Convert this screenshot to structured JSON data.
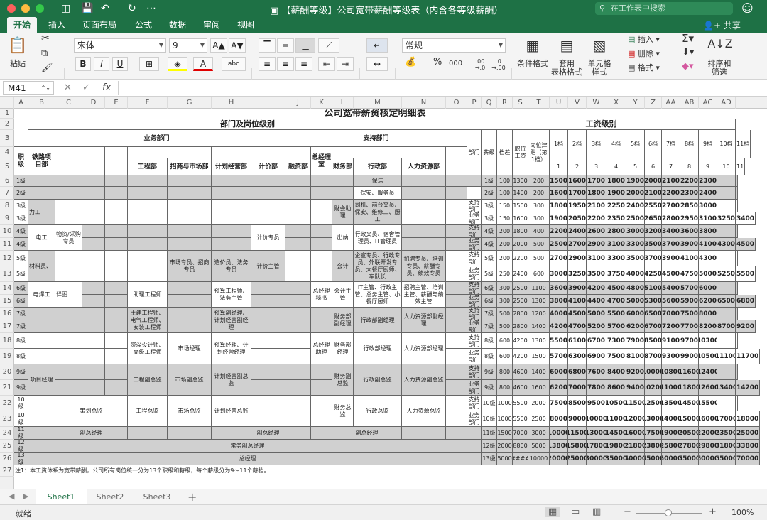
{
  "window": {
    "title": "【薪酬等级】公司宽带薪酬等级表（内含各等级薪酬）",
    "search_placeholder": "在工作表中搜索"
  },
  "menu_tabs": [
    "开始",
    "插入",
    "页面布局",
    "公式",
    "数据",
    "审阅",
    "视图"
  ],
  "share_label": "共享",
  "ribbon": {
    "paste": "粘贴",
    "font_name": "宋体",
    "font_size": "9",
    "bold": "B",
    "italic": "I",
    "underline": "U",
    "font_grow": "A",
    "font_shrink": "A",
    "number_format": "常规",
    "percent": "%",
    "thousands": "000",
    "dec_inc": ".00 →.0",
    "dec_dec": ".0 →.00",
    "cond_format": "条件格式",
    "table_format": "套用\n表格格式",
    "cell_style": "单元格\n样式",
    "insert": "插入",
    "delete": "删除",
    "format": "格式",
    "sort_filter": "排序和\n筛选",
    "icons": {
      "cut": "scissors-icon",
      "copy": "copy-icon",
      "brush": "format-painter-icon",
      "fill": "fill-color-icon",
      "sum": "autosum-icon"
    }
  },
  "formula_bar": {
    "name_box": "M41",
    "fx": "fx"
  },
  "columns": [
    "A",
    "B",
    "C",
    "D",
    "E",
    "F",
    "G",
    "H",
    "I",
    "J",
    "K",
    "L",
    "M",
    "N",
    "O",
    "P",
    "Q",
    "R",
    "S",
    "T",
    "U",
    "V",
    "W",
    "X",
    "Y",
    "Z",
    "AA",
    "AB",
    "AC",
    "AD"
  ],
  "rows": [
    "1",
    "2",
    "3",
    "4",
    "5",
    "6",
    "7",
    "8",
    "9",
    "10",
    "11",
    "12",
    "13",
    "14",
    "15",
    "16",
    "17",
    "18",
    "19",
    "20",
    "21",
    "22",
    "23",
    "24",
    "25",
    "26",
    "27"
  ],
  "sheet": {
    "title": "公司宽带薪资核定明细表",
    "dept_level": "部门及岗位级别",
    "salary_level": "工资级别",
    "business_dept": "业务部门",
    "support_dept": "支持部门",
    "rank": "职级",
    "railway_dept": "铁路项目部",
    "engineering": "工程部",
    "bidding": "招商与市场部",
    "planning": "计划经营部",
    "pricing": "计价部",
    "finance": "融资部",
    "gm_office": "总经理室",
    "finance2": "财务部",
    "admin": "行政部",
    "hr": "人力资源部",
    "dept": "部门",
    "grade": "薪级",
    "diff": "档差",
    "base": "职位工资",
    "allow": "岗位津贴（第1档）",
    "band_labels": [
      "1档",
      "2档",
      "3档",
      "4档",
      "5档",
      "6档",
      "7档",
      "8档",
      "9档",
      "10档",
      "11档"
    ],
    "band_nums": [
      "1",
      "2",
      "3",
      "4",
      "5",
      "6",
      "7",
      "8",
      "9",
      "10",
      "11"
    ],
    "notes": "注1：本工资体系为宽带薪酬，公司所有岗位统一分为13个职级和薪级，每个薪级分为9～11个薪档。",
    "deputy_gm": "常务副总经理",
    "gm": "总经理",
    "labels": {
      "baoJie": "保洁",
      "baoAn": "保安、服务员",
      "liGong": "力工",
      "siJi": "司机、前台文员、保安、维修工、厨工",
      "caiWuZhuLi": "财会助理",
      "dianGong": "电工",
      "wuZi": "物资/采购专员",
      "jiJiaZY": "计价专员",
      "chuNa": "出纳",
      "xingZhengWY": "行政文员、宿舍管理员、IT管理员",
      "caiLiao": "材料员、",
      "shiChangZY": "市场专员、招商专员",
      "zaoJiaZY": "造价员、法务专员",
      "jiJiaZG": "计价主管",
      "kuaiJi": "会计",
      "qiXuan": "企宣专员、行政专员、外联开发专员、大餐厅厨师、车队长",
      "zhaoPin": "招聘专员、培训专员、薪酬专员、绩效专员",
      "dianHan": "电焊工",
      "xiangTu": "详图",
      "zhuLiGCS": "助理工程师",
      "yuSuanGCS": "预算工程师、法务主管",
      "zongMiShu": "总经理秘书",
      "kuaiJiZhuGuan": "会计主管",
      "itZhuGuan": "IT主管、行政主管、总务主管、小餐厅厨师",
      "zhaoPinZG": "招聘主管、培训主管、薪酬与绩效主管",
      "tuJianGCS": "土建工程师、电气工程师、安装工程师",
      "yuSuanFJL": "预算副经理、计划经营副经理",
      "caiWuFJL": "财务部副经理",
      "xingZhengFJL": "行政部副经理",
      "renLiFJL": "人力资源部副经理",
      "ziShenSheJi": "资深设计师、高级工程师",
      "shiChangJL": "市场经理",
      "yuSuanJL": "预算经理、计划经营经理",
      "zongJLZhuLi": "总经理助理",
      "caiWuJL": "财务部经理",
      "xingZhengJL": "行政部经理",
      "renLiJL": "人力资源部经理",
      "xiangMuJL": "项目经理",
      "gongChengFZJ": "工程副总监",
      "shiChangFZJ": "市场副总监",
      "jiHuaFZJ": "计划经营副总监",
      "caiWuFZJ": "财务副总监",
      "xingZhengFZJ": "行政副总监",
      "renLiFZJ": "人力资源副总监",
      "ceHuaZJ": "策划总监",
      "gongChengZJ": "工程总监",
      "shiChangZJ": "市场总监",
      "jiHuaZJ": "计划经营总监",
      "caiWuZJ": "财务总监",
      "xingZhengZJ": "行政总监",
      "renLiZJ": "人力资源总监",
      "fuZongJL": "副总经理",
      "zhiChi": "支持部门",
      "yeWu": "业务部门"
    },
    "pay_rows": [
      [
        "1级",
        "100",
        "1300",
        "200",
        "1500",
        "1600",
        "1700",
        "1800",
        "1900",
        "2000",
        "2100",
        "2200",
        "2300",
        "",
        ""
      ],
      [
        "2级",
        "100",
        "1400",
        "200",
        "1600",
        "1700",
        "1800",
        "1900",
        "2000",
        "2100",
        "2200",
        "2300",
        "2400",
        "",
        ""
      ],
      [
        "3级",
        "150",
        "1500",
        "300",
        "1800",
        "1950",
        "2100",
        "2250",
        "2400",
        "2550",
        "2700",
        "2850",
        "3000",
        "",
        ""
      ],
      [
        "3级",
        "150",
        "1600",
        "300",
        "1900",
        "2050",
        "2200",
        "2350",
        "2500",
        "2650",
        "2800",
        "2950",
        "3100",
        "3250",
        "3400"
      ],
      [
        "4级",
        "200",
        "1800",
        "400",
        "2200",
        "2400",
        "2600",
        "2800",
        "3000",
        "3200",
        "3400",
        "3600",
        "3800",
        "",
        ""
      ],
      [
        "4级",
        "200",
        "2000",
        "500",
        "2500",
        "2700",
        "2900",
        "3100",
        "3300",
        "3500",
        "3700",
        "3900",
        "4100",
        "4300",
        "4500"
      ],
      [
        "5级",
        "200",
        "2200",
        "500",
        "2700",
        "2900",
        "3100",
        "3300",
        "3500",
        "3700",
        "3900",
        "4100",
        "4300",
        "",
        ""
      ],
      [
        "5级",
        "250",
        "2400",
        "600",
        "3000",
        "3250",
        "3500",
        "3750",
        "4000",
        "4250",
        "4500",
        "4750",
        "5000",
        "5250",
        "5500"
      ],
      [
        "6级",
        "300",
        "2500",
        "1100",
        "3600",
        "3900",
        "4200",
        "4500",
        "4800",
        "5100",
        "5400",
        "5700",
        "6000",
        "",
        ""
      ],
      [
        "6级",
        "300",
        "2500",
        "1300",
        "3800",
        "4100",
        "4400",
        "4700",
        "5000",
        "5300",
        "5600",
        "5900",
        "6200",
        "6500",
        "6800"
      ],
      [
        "7级",
        "500",
        "2800",
        "1200",
        "4000",
        "4500",
        "5000",
        "5500",
        "6000",
        "6500",
        "7000",
        "7500",
        "8000",
        "",
        ""
      ],
      [
        "7级",
        "500",
        "2800",
        "1400",
        "4200",
        "4700",
        "5200",
        "5700",
        "6200",
        "6700",
        "7200",
        "7700",
        "8200",
        "8700",
        "9200"
      ],
      [
        "8级",
        "600",
        "4200",
        "1300",
        "5500",
        "6100",
        "6700",
        "7300",
        "7900",
        "8500",
        "9100",
        "9700",
        "10300",
        "",
        ""
      ],
      [
        "8级",
        "600",
        "4200",
        "1500",
        "5700",
        "6300",
        "6900",
        "7500",
        "8100",
        "8700",
        "9300",
        "9900",
        "10500",
        "11100",
        "11700"
      ],
      [
        "9级",
        "800",
        "4600",
        "1400",
        "6000",
        "6800",
        "7600",
        "8400",
        "9200",
        "10000",
        "10800",
        "11600",
        "12400",
        "",
        ""
      ],
      [
        "9级",
        "800",
        "4600",
        "1600",
        "6200",
        "7000",
        "7800",
        "8600",
        "9400",
        "10200",
        "11000",
        "11800",
        "12600",
        "13400",
        "14200"
      ],
      [
        "10级",
        "1000",
        "5500",
        "2000",
        "7500",
        "8500",
        "9500",
        "10500",
        "11500",
        "12500",
        "13500",
        "14500",
        "15500",
        "",
        ""
      ],
      [
        "10级",
        "1000",
        "5500",
        "2500",
        "8000",
        "9000",
        "10000",
        "11000",
        "12000",
        "13000",
        "14000",
        "15000",
        "16000",
        "17000",
        "18000"
      ],
      [
        "11级",
        "1500",
        "7000",
        "3000",
        "10000",
        "11500",
        "13000",
        "14500",
        "16000",
        "17500",
        "19000",
        "20500",
        "22000",
        "23500",
        "25000"
      ],
      [
        "12级",
        "2000",
        "8800",
        "5000",
        "13800",
        "15800",
        "17800",
        "19800",
        "21800",
        "23800",
        "25800",
        "27800",
        "29800",
        "31800",
        "33800"
      ],
      [
        "13级",
        "5000",
        "######",
        "10000",
        "20000",
        "25000",
        "30000",
        "35000",
        "40000",
        "45000",
        "50000",
        "55000",
        "60000",
        "65000",
        "70000"
      ]
    ],
    "row_ranks": [
      "1级",
      "2级",
      "3级",
      "3级",
      "4级",
      "4级",
      "5级",
      "5级",
      "6级",
      "6级",
      "7级",
      "7级",
      "8级",
      "8级",
      "9级",
      "9级",
      "10级",
      "10级",
      "11级",
      "12级",
      "13级"
    ]
  },
  "sheet_tabs": [
    "Sheet1",
    "Sheet2",
    "Sheet3"
  ],
  "status": {
    "ready": "就绪",
    "zoom": "100%"
  }
}
